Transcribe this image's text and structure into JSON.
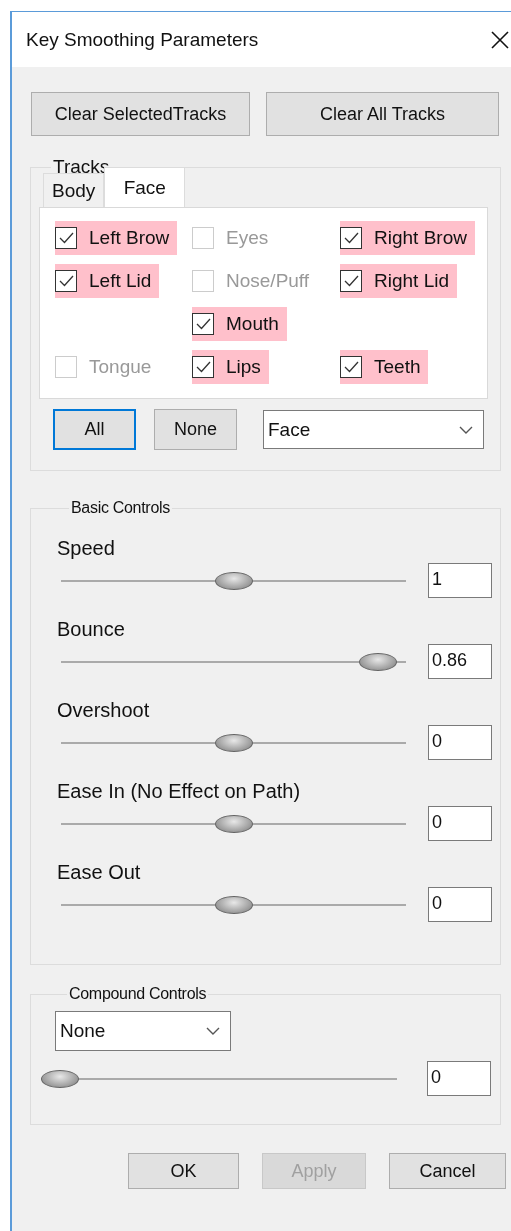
{
  "window": {
    "title": "Key Smoothing Parameters"
  },
  "top_buttons": [
    "Clear SelectedTracks",
    "Clear All Tracks"
  ],
  "tracks": {
    "title": "Tracks",
    "tabs": [
      {
        "label": "Body",
        "selected": false
      },
      {
        "label": "Face",
        "selected": true
      }
    ],
    "rows": [
      [
        {
          "kind": "checkbox",
          "label": "Left Brow",
          "checked": true
        },
        {
          "kind": "checkbox",
          "label": "Eyes",
          "checked": false
        },
        {
          "kind": "checkbox",
          "label": "Right Brow",
          "checked": true
        }
      ],
      [
        {
          "kind": "checkbox",
          "label": "Left Lid",
          "checked": true
        },
        {
          "kind": "checkbox",
          "label": "Nose/Puff",
          "checked": false
        },
        {
          "kind": "checkbox",
          "label": "Right Lid",
          "checked": true
        }
      ],
      [
        {
          "kind": "blank"
        },
        {
          "kind": "checkbox",
          "label": "Mouth",
          "checked": true
        },
        {
          "kind": "blank"
        }
      ],
      [
        {
          "kind": "checkbox",
          "label": "Tongue",
          "checked": false
        },
        {
          "kind": "checkbox",
          "label": "Lips",
          "checked": true
        },
        {
          "kind": "checkbox",
          "label": "Teeth",
          "checked": true
        }
      ]
    ],
    "buttons": [
      {
        "label": "All",
        "focused": true
      },
      {
        "label": "None",
        "focused": false
      }
    ],
    "dropdown": {
      "value": "Face"
    }
  },
  "basic_controls": {
    "title": "Basic Controls",
    "sliders": [
      {
        "label": "Speed",
        "level": 0.5,
        "value": "1"
      },
      {
        "label": "Bounce",
        "level": 0.97,
        "value": "0.86"
      },
      {
        "label": "Overshoot",
        "level": 0.5,
        "value": "0"
      },
      {
        "label": "Ease In (No Effect on Path)",
        "level": 0.5,
        "value": "0"
      },
      {
        "label": "Ease Out",
        "level": 0.5,
        "value": "0"
      }
    ]
  },
  "compound_controls": {
    "title": "Compound Controls",
    "dropdown": {
      "value": "None"
    },
    "slider": {
      "level": 0,
      "value": "0"
    }
  },
  "footer_buttons": [
    {
      "label": "OK",
      "disabled": false
    },
    {
      "label": "Apply",
      "disabled": true
    },
    {
      "label": "Cancel",
      "disabled": false
    }
  ]
}
